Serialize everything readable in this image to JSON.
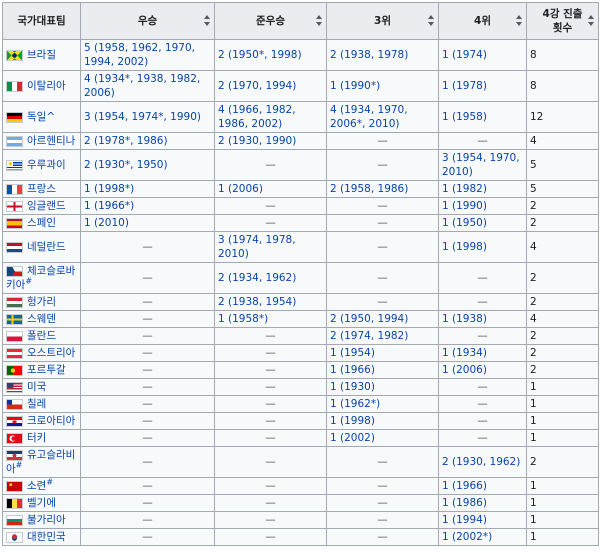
{
  "headers": {
    "team": "국가대표팀",
    "champion": "우승",
    "runner_up": "준우승",
    "third": "3위",
    "fourth": "4위",
    "top4": "4강 진출 횟수"
  },
  "rows": [
    {
      "name": "브라질",
      "sup": "",
      "flag": "brazil",
      "c1": "5 (1958, 1962, 1970, 1994, 2002)",
      "c2": "2 (1950*, 1998)",
      "c3": "2 (1938, 1978)",
      "c4": "1 (1974)",
      "total": "8"
    },
    {
      "name": "이탈리아",
      "sup": "",
      "flag": "italy",
      "c1": "4 (1934*, 1938, 1982, 2006)",
      "c2": "2 (1970, 1994)",
      "c3": "1 (1990*)",
      "c4": "1 (1978)",
      "total": "8"
    },
    {
      "name": "독일^",
      "sup": "",
      "flag": "germany",
      "c1": "3 (1954, 1974*, 1990)",
      "c2": "4 (1966, 1982, 1986, 2002)",
      "c3": "4 (1934, 1970, 2006*, 2010)",
      "c4": "1 (1958)",
      "total": "12"
    },
    {
      "name": "아르헨티나",
      "sup": "",
      "flag": "argentina",
      "c1": "2 (1978*, 1986)",
      "c2": "2 (1930, 1990)",
      "c3": "—",
      "c4": "—",
      "total": "4"
    },
    {
      "name": "우루과이",
      "sup": "",
      "flag": "uruguay",
      "c1": "2 (1930*, 1950)",
      "c2": "—",
      "c3": "—",
      "c4": "3 (1954, 1970, 2010)",
      "total": "5"
    },
    {
      "name": "프랑스",
      "sup": "",
      "flag": "france",
      "c1": "1 (1998*)",
      "c2": "1 (2006)",
      "c3": "2 (1958, 1986)",
      "c4": "1 (1982)",
      "total": "5"
    },
    {
      "name": "잉글랜드",
      "sup": "",
      "flag": "england",
      "c1": "1 (1966*)",
      "c2": "—",
      "c3": "—",
      "c4": "1 (1990)",
      "total": "2"
    },
    {
      "name": "스페인",
      "sup": "",
      "flag": "spain",
      "c1": "1 (2010)",
      "c2": "—",
      "c3": "—",
      "c4": "1 (1950)",
      "total": "2"
    },
    {
      "name": "네덜란드",
      "sup": "",
      "flag": "netherlands",
      "c1": "—",
      "c2": "3 (1974, 1978, 2010)",
      "c3": "—",
      "c4": "1 (1998)",
      "total": "4"
    },
    {
      "name": "체코슬로바키아",
      "sup": "#",
      "flag": "czechoslovakia",
      "c1": "—",
      "c2": "2 (1934, 1962)",
      "c3": "—",
      "c4": "—",
      "total": "2"
    },
    {
      "name": "헝가리",
      "sup": "",
      "flag": "hungary",
      "c1": "—",
      "c2": "2 (1938, 1954)",
      "c3": "—",
      "c4": "—",
      "total": "2"
    },
    {
      "name": "스웨덴",
      "sup": "",
      "flag": "sweden",
      "c1": "—",
      "c2": "1 (1958*)",
      "c3": "2 (1950, 1994)",
      "c4": "1 (1938)",
      "total": "4"
    },
    {
      "name": "폴란드",
      "sup": "",
      "flag": "poland",
      "c1": "—",
      "c2": "—",
      "c3": "2 (1974, 1982)",
      "c4": "—",
      "total": "2"
    },
    {
      "name": "오스트리아",
      "sup": "",
      "flag": "austria",
      "c1": "—",
      "c2": "—",
      "c3": "1 (1954)",
      "c4": "1 (1934)",
      "total": "2"
    },
    {
      "name": "포르투갈",
      "sup": "",
      "flag": "portugal",
      "c1": "—",
      "c2": "—",
      "c3": "1 (1966)",
      "c4": "1 (2006)",
      "total": "2"
    },
    {
      "name": "미국",
      "sup": "",
      "flag": "usa",
      "c1": "—",
      "c2": "—",
      "c3": "1 (1930)",
      "c4": "—",
      "total": "1"
    },
    {
      "name": "칠레",
      "sup": "",
      "flag": "chile",
      "c1": "—",
      "c2": "—",
      "c3": "1 (1962*)",
      "c4": "—",
      "total": "1"
    },
    {
      "name": "크로아티아",
      "sup": "",
      "flag": "croatia",
      "c1": "—",
      "c2": "—",
      "c3": "1 (1998)",
      "c4": "—",
      "total": "1"
    },
    {
      "name": "터키",
      "sup": "",
      "flag": "turkey",
      "c1": "—",
      "c2": "—",
      "c3": "1 (2002)",
      "c4": "—",
      "total": "1"
    },
    {
      "name": "유고슬라비아",
      "sup": "#",
      "flag": "yugoslavia",
      "c1": "—",
      "c2": "—",
      "c3": "—",
      "c4": "2 (1930, 1962)",
      "total": "2"
    },
    {
      "name": "소련",
      "sup": "#",
      "flag": "ussr",
      "c1": "—",
      "c2": "—",
      "c3": "—",
      "c4": "1 (1966)",
      "total": "1"
    },
    {
      "name": "벨기에",
      "sup": "",
      "flag": "belgium",
      "c1": "—",
      "c2": "—",
      "c3": "—",
      "c4": "1 (1986)",
      "total": "1"
    },
    {
      "name": "불가리아",
      "sup": "",
      "flag": "bulgaria",
      "c1": "—",
      "c2": "—",
      "c3": "—",
      "c4": "1 (1994)",
      "total": "1"
    },
    {
      "name": "대한민국",
      "sup": "",
      "flag": "korea",
      "c1": "—",
      "c2": "—",
      "c3": "—",
      "c4": "1 (2002*)",
      "total": "1"
    }
  ],
  "colors": {
    "link": "#0645ad",
    "header_bg": "#eaecf0",
    "cell_bg": "#f8f9fa",
    "border": "#a2a9b1"
  }
}
